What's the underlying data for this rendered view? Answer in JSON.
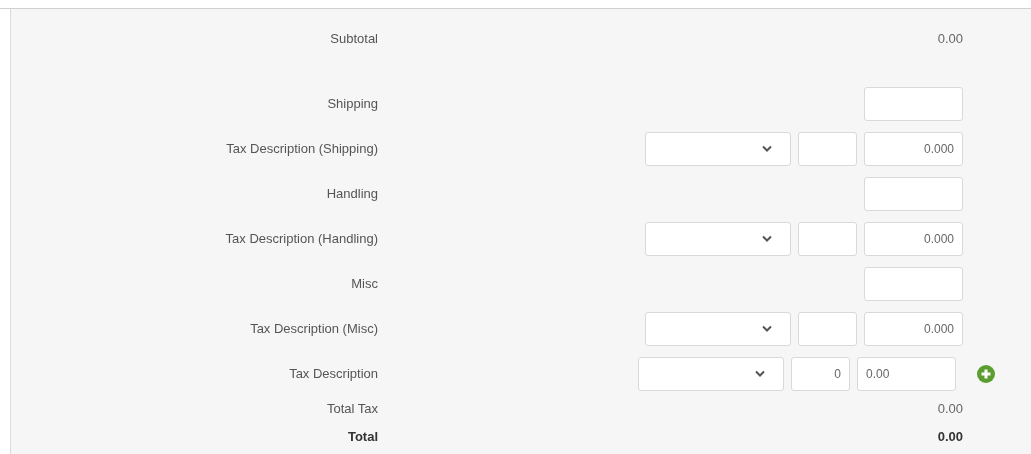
{
  "rows": [
    {
      "kind": "value",
      "label": "Subtotal",
      "value": "0.00"
    },
    {
      "kind": "input",
      "label": "Shipping"
    },
    {
      "kind": "tax",
      "label": "Tax Description (Shipping)",
      "amount": "0.000"
    },
    {
      "kind": "input",
      "label": "Handling"
    },
    {
      "kind": "tax",
      "label": "Tax Description (Handling)",
      "amount": "0.000"
    },
    {
      "kind": "input",
      "label": "Misc"
    },
    {
      "kind": "tax",
      "label": "Tax Description (Misc)",
      "amount": "0.000"
    },
    {
      "kind": "tax_add",
      "label": "Tax Description",
      "rate": "0",
      "amount": "0.00"
    },
    {
      "kind": "value",
      "label": "Total Tax",
      "value": "0.00"
    },
    {
      "kind": "total",
      "label": "Total",
      "value": "0.00"
    }
  ]
}
